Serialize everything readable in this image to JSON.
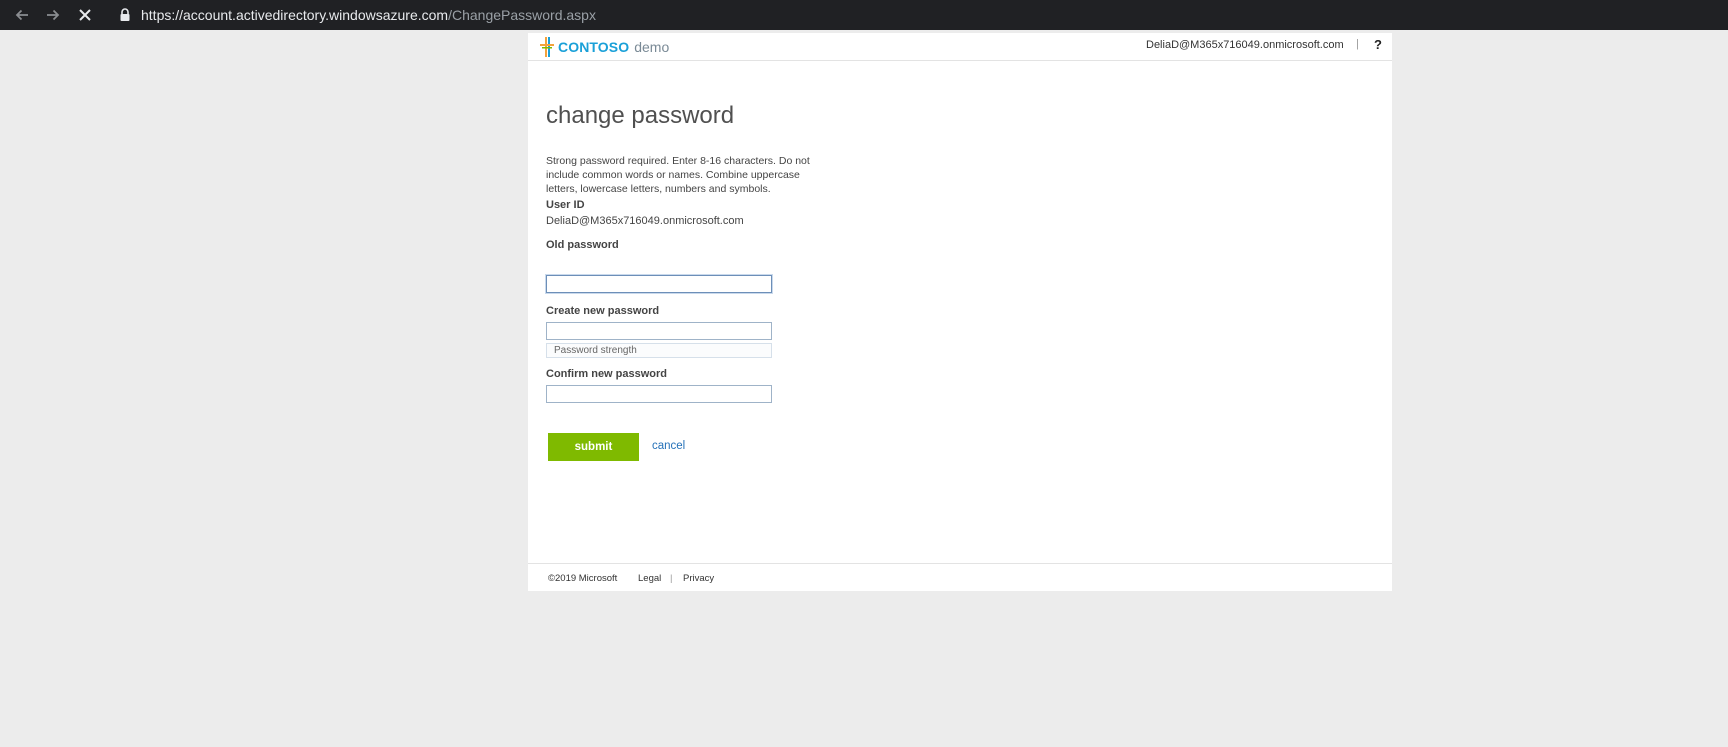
{
  "browser": {
    "url_domain": "https://account.activedirectory.windowsazure.com",
    "url_path": "/ChangePassword.aspx",
    "icons": [
      "back-arrow-icon",
      "forward-arrow-icon",
      "stop-loading-icon",
      "lock-icon"
    ]
  },
  "header": {
    "brand": "CONTOSO",
    "brand_sub": "demo",
    "user_email": "DeliaD@M365x716049.onmicrosoft.com",
    "separator": "|",
    "help": "?"
  },
  "page": {
    "title": "change password",
    "description": "Strong password required. Enter 8-16 characters. Do not include common words or names. Combine uppercase letters, lowercase letters, numbers and symbols."
  },
  "form": {
    "user_id_label": "User ID",
    "user_id_value": "DeliaD@M365x716049.onmicrosoft.com",
    "old_password_label": "Old password",
    "old_password_value": "",
    "new_password_label": "Create new password",
    "new_password_value": "",
    "strength_label": "Password strength",
    "confirm_password_label": "Confirm new password",
    "confirm_password_value": "",
    "submit_label": "submit",
    "cancel_label": "cancel"
  },
  "footer": {
    "copyright": "©2019 Microsoft",
    "legal": "Legal",
    "separator": "|",
    "privacy": "Privacy"
  },
  "colors": {
    "submit": "#7fba00",
    "brand": "#1aa0d8",
    "link": "#2672b9"
  }
}
